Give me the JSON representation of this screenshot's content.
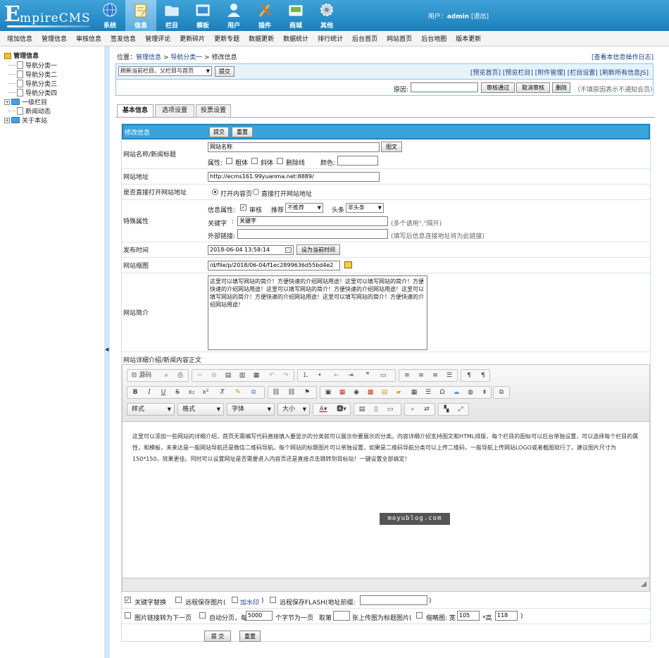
{
  "app": {
    "logo": {
      "initial": "E",
      "rest": "mpireCMS"
    },
    "nav": [
      {
        "label": "系统",
        "icon": "globe-icon"
      },
      {
        "label": "信息",
        "icon": "edit-icon"
      },
      {
        "label": "栏目",
        "icon": "folder-icon"
      },
      {
        "label": "模板",
        "icon": "template-icon"
      },
      {
        "label": "用户",
        "icon": "user-icon"
      },
      {
        "label": "插件",
        "icon": "plugin-icon"
      },
      {
        "label": "商城",
        "icon": "shop-icon"
      },
      {
        "label": "其他",
        "icon": "gear-icon"
      }
    ],
    "user_prefix": "用户：",
    "user_name": "admin",
    "logout": "[退出]"
  },
  "menubar": [
    "增加信息",
    "管理信息",
    "审核信息",
    "签发信息",
    "管理评论",
    "更新碎片",
    "更新专题",
    "数据更新",
    "数据统计",
    "排行统计",
    "后台首页",
    "网站首页",
    "后台地图",
    "版本更新"
  ],
  "sidebar": {
    "root": "管理信息",
    "items": [
      "导航分类一",
      "导航分类二",
      "导航分类三",
      "导航分类四",
      "一级栏目",
      "新闻动态",
      "关于本站"
    ]
  },
  "location": {
    "prefix": "位置：",
    "crumb1": "管理信息",
    "sep1": " > ",
    "crumb2": "导航分类一",
    "sep2": " > ",
    "current": "修改信息"
  },
  "log_link": "[查看本信息操作日志]",
  "toolbox": {
    "refresh_select": "刷新当前栏目、父栏目与首页",
    "submit": "提交",
    "links": [
      "[预览首页]",
      "[预览栏目]",
      "[附件管理]",
      "[栏目设置]",
      "[刷新所有信息JS]"
    ],
    "reason_label": "原因:",
    "approve": "审核通过",
    "cancel_approve": "取消审核",
    "delete": "删除",
    "reason_hint": "（不填原因表示不通知会员）"
  },
  "tabs": [
    "基本信息",
    "选项设置",
    "投票设置"
  ],
  "form": {
    "header": "修改信息",
    "submit": "提交",
    "reset": "重置",
    "title_label": "网站名称/新闻标题",
    "title_value": "网站名称",
    "title_img_btn": "图文",
    "attr_label": "属性:",
    "bold": "粗体",
    "italic": "斜体",
    "strike": "删除线",
    "color_label": "颜色:",
    "url_label": "网站地址",
    "url_value": "http://ecms161.99yuanma.net:8889/",
    "open_label": "是否直接打开网站地址",
    "open_opt1": "打开内容页",
    "open_opt2": "直接打开网站地址",
    "special_label": "特殊属性",
    "info_attr_label": "信息属性:",
    "audit": "审核",
    "recommend_label": "推荐",
    "recommend_value": "不推荐",
    "headline_label": "头条",
    "headline_value": "非头条",
    "keyword_label": "关键字",
    "keyword_value": "关键字",
    "keyword_hint": "(多个请用\",\"隔开)",
    "external_label": "外部链接:",
    "external_hint": "(填写后信息连接地址将为此链接)",
    "time_label": "发布时间",
    "time_value": "2018-06-04 13:58:14",
    "time_btn": "设为当前时间",
    "thumb_label": "网站缩图",
    "thumb_value": "/d/file/p/2018/06-04/f1ec2899636d55bd4e2",
    "intro_label": "网站简介",
    "intro_value": "这里可以填写网站的简介！方便快速的介绍网站用途！这里可以填写网站的简介！方便快速的介绍网站用途！这里可以填写网站的简介！方便快速的介绍网站用途！这里可以填写网站的简介！方便快速的介绍网站用途！这里可以填写网站的简介！方便快速的介绍网站用途！",
    "detail_label": "网站详细介绍/新闻内容正文",
    "editor_source": "源码",
    "editor_style": "样式",
    "editor_format": "格式",
    "editor_font": "字体",
    "editor_size": "大小",
    "editor_text": "这里可以添加一些网站的详细介绍，首页无需编写代码直接填入要显示的分类就可以展示你要展示的分类。内容详细介绍支持图文和HTML排版，每个栏目的图标可以后台单独设置，可以选择每个栏目的属性，和模板，未来达是一般网站导航还是微信二维码导航。每个网站的标题图片可以单独设置，如果是二维码导航分类可以上传二维码，一般导航上传网站LOGO或者截图就行了。建议图片尺寸为150*150，效果更佳。同时可以设置网址是否需要进入内容页还是直接点击跳转到目标站！一键设置全部搞定！",
    "watermark": "moyublog.com",
    "opt_keyword_replace": "关键字替换",
    "opt_remote_img": "远程保存图片(",
    "opt_watermark": "加水印",
    "opt_watermark_close": ")",
    "opt_remote_flash": "远程保存FLASH(地址前缀:",
    "opt_close": ")",
    "opt_img_link": "图片链接转为下一页",
    "opt_autopage": "自动分页，每",
    "opt_autopage_value": "5000",
    "opt_autopage_unit": "个字节为一页",
    "opt_take": "取第",
    "opt_take_suffix": "张上传图为标题图片(",
    "opt_thumb": "缩略图: 宽",
    "opt_width": "105",
    "opt_height_label": "*高",
    "opt_height": "118",
    "opt_thumb_close": ")"
  },
  "bottom": {
    "submit": "提 交",
    "reset": "重置"
  }
}
